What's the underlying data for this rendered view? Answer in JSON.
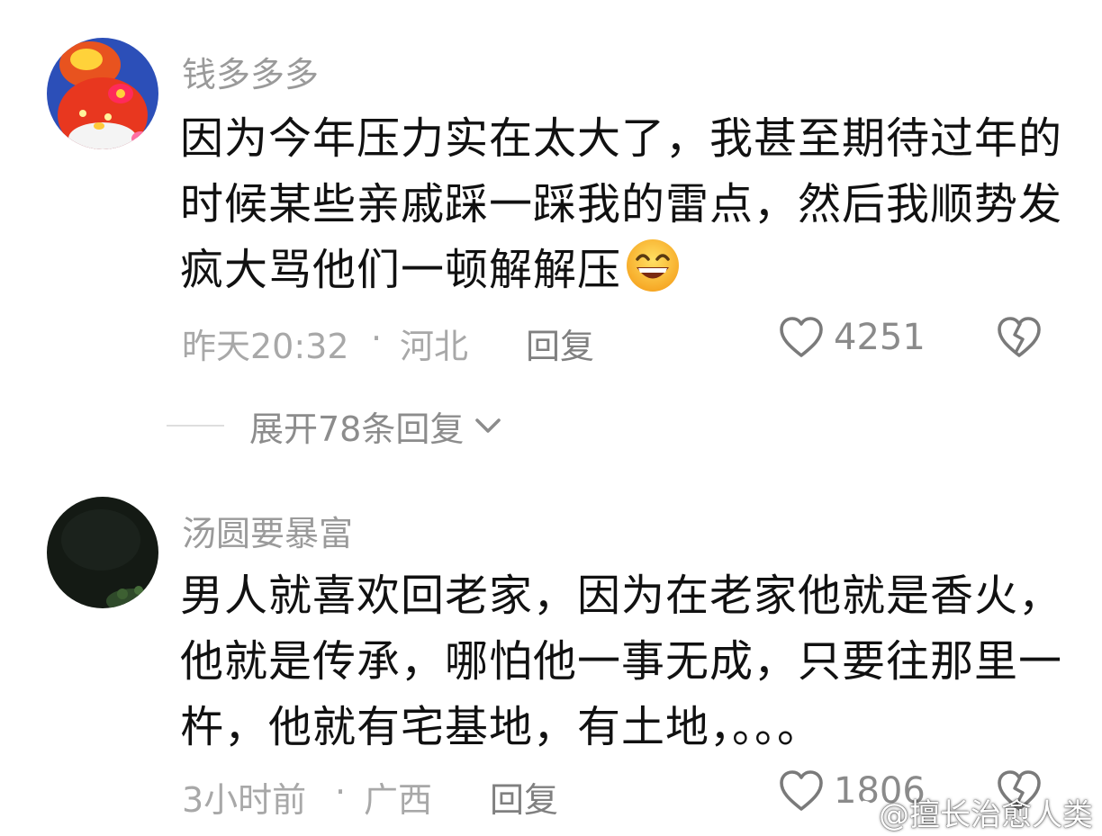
{
  "comments": [
    {
      "username": "钱多多多",
      "text": "因为今年压力实在太大了，我甚至期待过年的时候某些亲戚踩一踩我的雷点，然后我顺势发疯大骂他们一顿解解压",
      "emoji": "grinning-face-emoji",
      "time": "昨天20:32",
      "separator": "·",
      "location": "河北",
      "reply_label": "回复",
      "like_count": "4251",
      "expand_replies": "展开78条回复"
    },
    {
      "username": "汤圆要暴富",
      "text": "男人就喜欢回老家，因为在老家他就是香火，他就是传承，哪怕他一事无成，只要往那里一杵，他就有宅基地，有土地，。。。",
      "time": "3小时前",
      "separator": "·",
      "location": "广西",
      "reply_label": "回复",
      "like_count": "1806"
    }
  ],
  "watermark": "@擅长治愈人类",
  "icons": {
    "like": "heart-outline-icon",
    "dislike": "broken-heart-icon",
    "expand": "chevron-down-icon",
    "watermark": "weibo-logo-icon"
  },
  "colors": {
    "text": "#111111",
    "meta": "#a8a8a8",
    "username": "#9a9a9a",
    "icon": "#7a7a7a"
  }
}
